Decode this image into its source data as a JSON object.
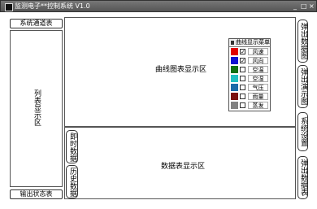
{
  "window": {
    "title": "监测电子**控制系统 V1.0",
    "controls": [
      "_",
      "□",
      "×"
    ]
  },
  "left": {
    "top_button": "系统通道表",
    "list_area": "列表显示区",
    "bottom_button": "输出状态表"
  },
  "chart_area": {
    "label": "曲线图表显示区"
  },
  "data_area": {
    "label": "数据表显示区"
  },
  "tabs": [
    "即时数据",
    "历史数据"
  ],
  "right_buttons": [
    "弹出数据图",
    "弹出演示图",
    "系统设置",
    "弹出数据表"
  ],
  "legend": {
    "title": "曲线显示菜单",
    "items": [
      {
        "label": "风速",
        "color": "#e00000",
        "checked": true
      },
      {
        "label": "风向",
        "color": "#1010d0",
        "checked": true
      },
      {
        "label": "空温",
        "color": "#107010",
        "checked": false
      },
      {
        "label": "空湿",
        "color": "#20c0c0",
        "checked": false
      },
      {
        "label": "气压",
        "color": "#1a6aa8",
        "checked": false
      },
      {
        "label": "雨量",
        "color": "#7a1010",
        "checked": false
      },
      {
        "label": "蒸发",
        "color": "#808080",
        "checked": false
      }
    ]
  }
}
